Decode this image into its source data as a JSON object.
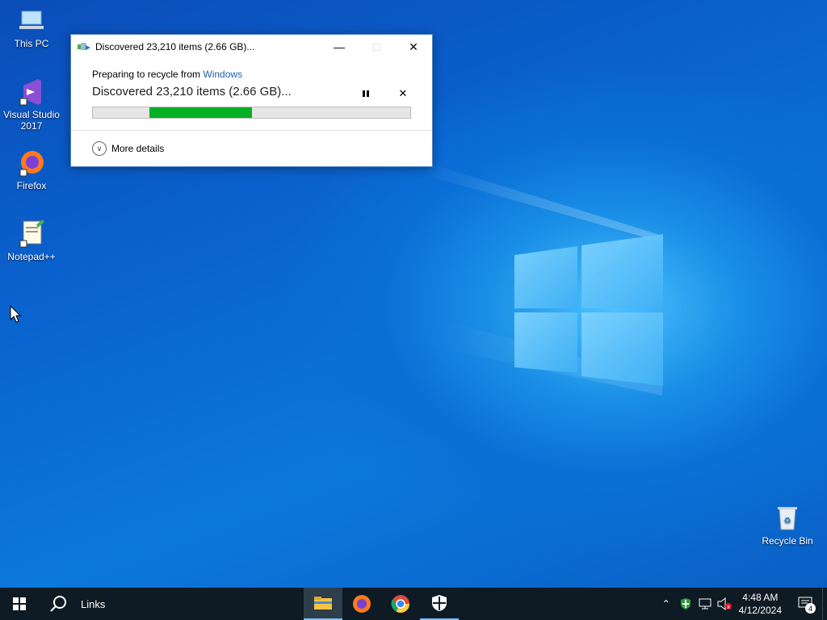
{
  "desktop": {
    "icons": [
      {
        "label": "This PC"
      },
      {
        "label": "Visual Studio 2017"
      },
      {
        "label": "Firefox"
      },
      {
        "label": "Notepad++"
      },
      {
        "label": "Recycle Bin"
      }
    ]
  },
  "dialog": {
    "title": "Discovered 23,210 items (2.66 GB)...",
    "preparing_prefix": "Preparing to recycle from ",
    "source_link": "Windows",
    "status": "Discovered 23,210 items (2.66 GB)...",
    "pause_icon": "pause-icon",
    "cancel_icon": "close-icon",
    "more_details": "More details",
    "progress_color": "#06b025"
  },
  "taskbar": {
    "search_label": "Links",
    "apps": [
      "file-explorer",
      "firefox",
      "chrome",
      "windows-security"
    ],
    "clock_time": "4:48 AM",
    "clock_date": "4/12/2024",
    "notification_count": "4"
  }
}
